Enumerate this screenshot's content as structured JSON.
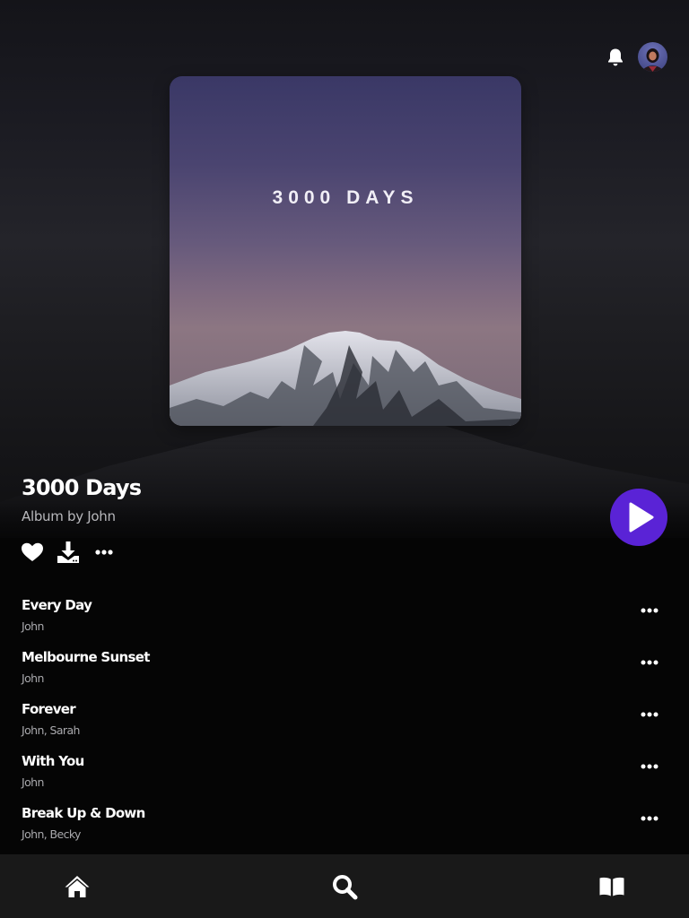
{
  "album": {
    "cover_text": "3000 DAYS",
    "title": "3000 Days",
    "subtitle": "Album by John"
  },
  "header": {
    "icons": [
      "bell-icon",
      "avatar"
    ]
  },
  "actions": {
    "icons": [
      "heart-icon",
      "download-icon",
      "more-horizontal-icon"
    ],
    "play_icon": "play-icon",
    "accent_color": "#5a23d6"
  },
  "tracks": [
    {
      "title": "Every Day",
      "artists": "John"
    },
    {
      "title": "Melbourne Sunset",
      "artists": "John"
    },
    {
      "title": "Forever",
      "artists": "John, Sarah"
    },
    {
      "title": "With You",
      "artists": "John"
    },
    {
      "title": "Break Up & Down",
      "artists": "John, Becky"
    }
  ],
  "nav": {
    "icons": [
      "home-icon",
      "search-icon",
      "library-book-icon"
    ]
  },
  "colors": {
    "background": "#050505",
    "nav_background": "#191919",
    "secondary_text": "#a9a9ad"
  }
}
